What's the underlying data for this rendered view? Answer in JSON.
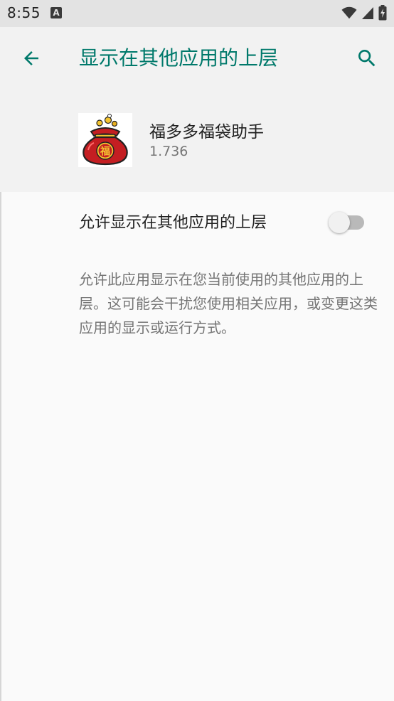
{
  "status_bar": {
    "time": "8:55",
    "notification_icon_letter": "A",
    "icons": [
      "wifi-icon",
      "cell-signal-icon",
      "battery-charging-icon"
    ]
  },
  "toolbar": {
    "title": "显示在其他应用的上层",
    "back_icon": "arrow-left-icon",
    "search_icon": "search-icon",
    "accent_color": "#00796b"
  },
  "app": {
    "name": "福多多福袋助手",
    "version": "1.736",
    "icon_character": "福"
  },
  "setting": {
    "label": "允许显示在其他应用的上层",
    "enabled": false
  },
  "summary": "允许此应用显示在您当前使用的其他应用的上层。这可能会干扰您使用相关应用，或变更这类应用的显示或运行方式。"
}
